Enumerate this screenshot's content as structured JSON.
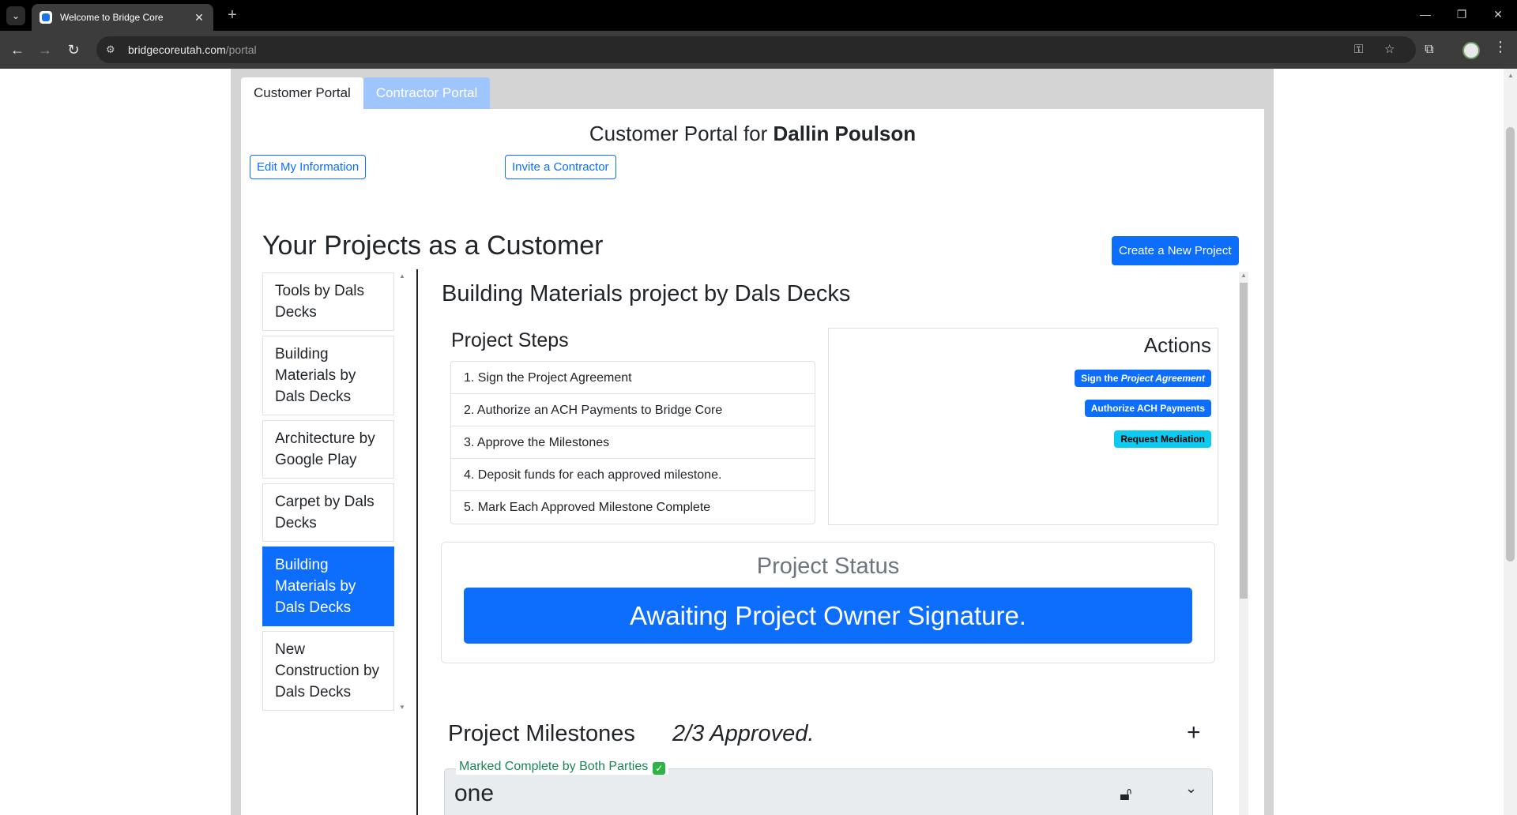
{
  "browser": {
    "tab_title": "Welcome to Bridge Core",
    "url_domain": "bridgecoreutah.com",
    "url_path": "/portal"
  },
  "portal_tabs": [
    "Customer Portal",
    "Contractor Portal"
  ],
  "heading": {
    "prefix": "Customer Portal for ",
    "name": "Dallin Poulson"
  },
  "buttons": {
    "edit_info": "Edit My Information",
    "invite_contractor": "Invite a Contractor",
    "create_project": "Create a New Project"
  },
  "projects_title": "Your Projects as a Customer",
  "projects": [
    "Tools by Dals Decks",
    "Building Materials by Dals Decks",
    "Architecture by Google Play",
    "Carpet by Dals Decks",
    "Building Materials by Dals Decks",
    "New Construction by Dals Decks"
  ],
  "active_project_index": 4,
  "project": {
    "title": "Building Materials project by Dals Decks",
    "steps_title": "Project Steps",
    "steps": [
      "1. Sign the Project Agreement",
      "2. Authorize an ACH Payments to Bridge Core",
      "3. Approve the Milestones",
      "4. Deposit funds for each approved milestone.",
      "5. Mark Each Approved Milestone Complete"
    ],
    "actions_title": "Actions",
    "actions": {
      "sign_prefix": "Sign the ",
      "sign_italic": "Project Agreement",
      "authorize": "Authorize ACH Payments",
      "mediation": "Request Mediation"
    },
    "status_label": "Project Status",
    "status": "Awaiting Project Owner Signature.",
    "milestones_title": "Project Milestones",
    "milestones_count": "2/3 Approved.",
    "milestone": {
      "legend": "Marked Complete by Both Parties",
      "name": "one"
    }
  }
}
